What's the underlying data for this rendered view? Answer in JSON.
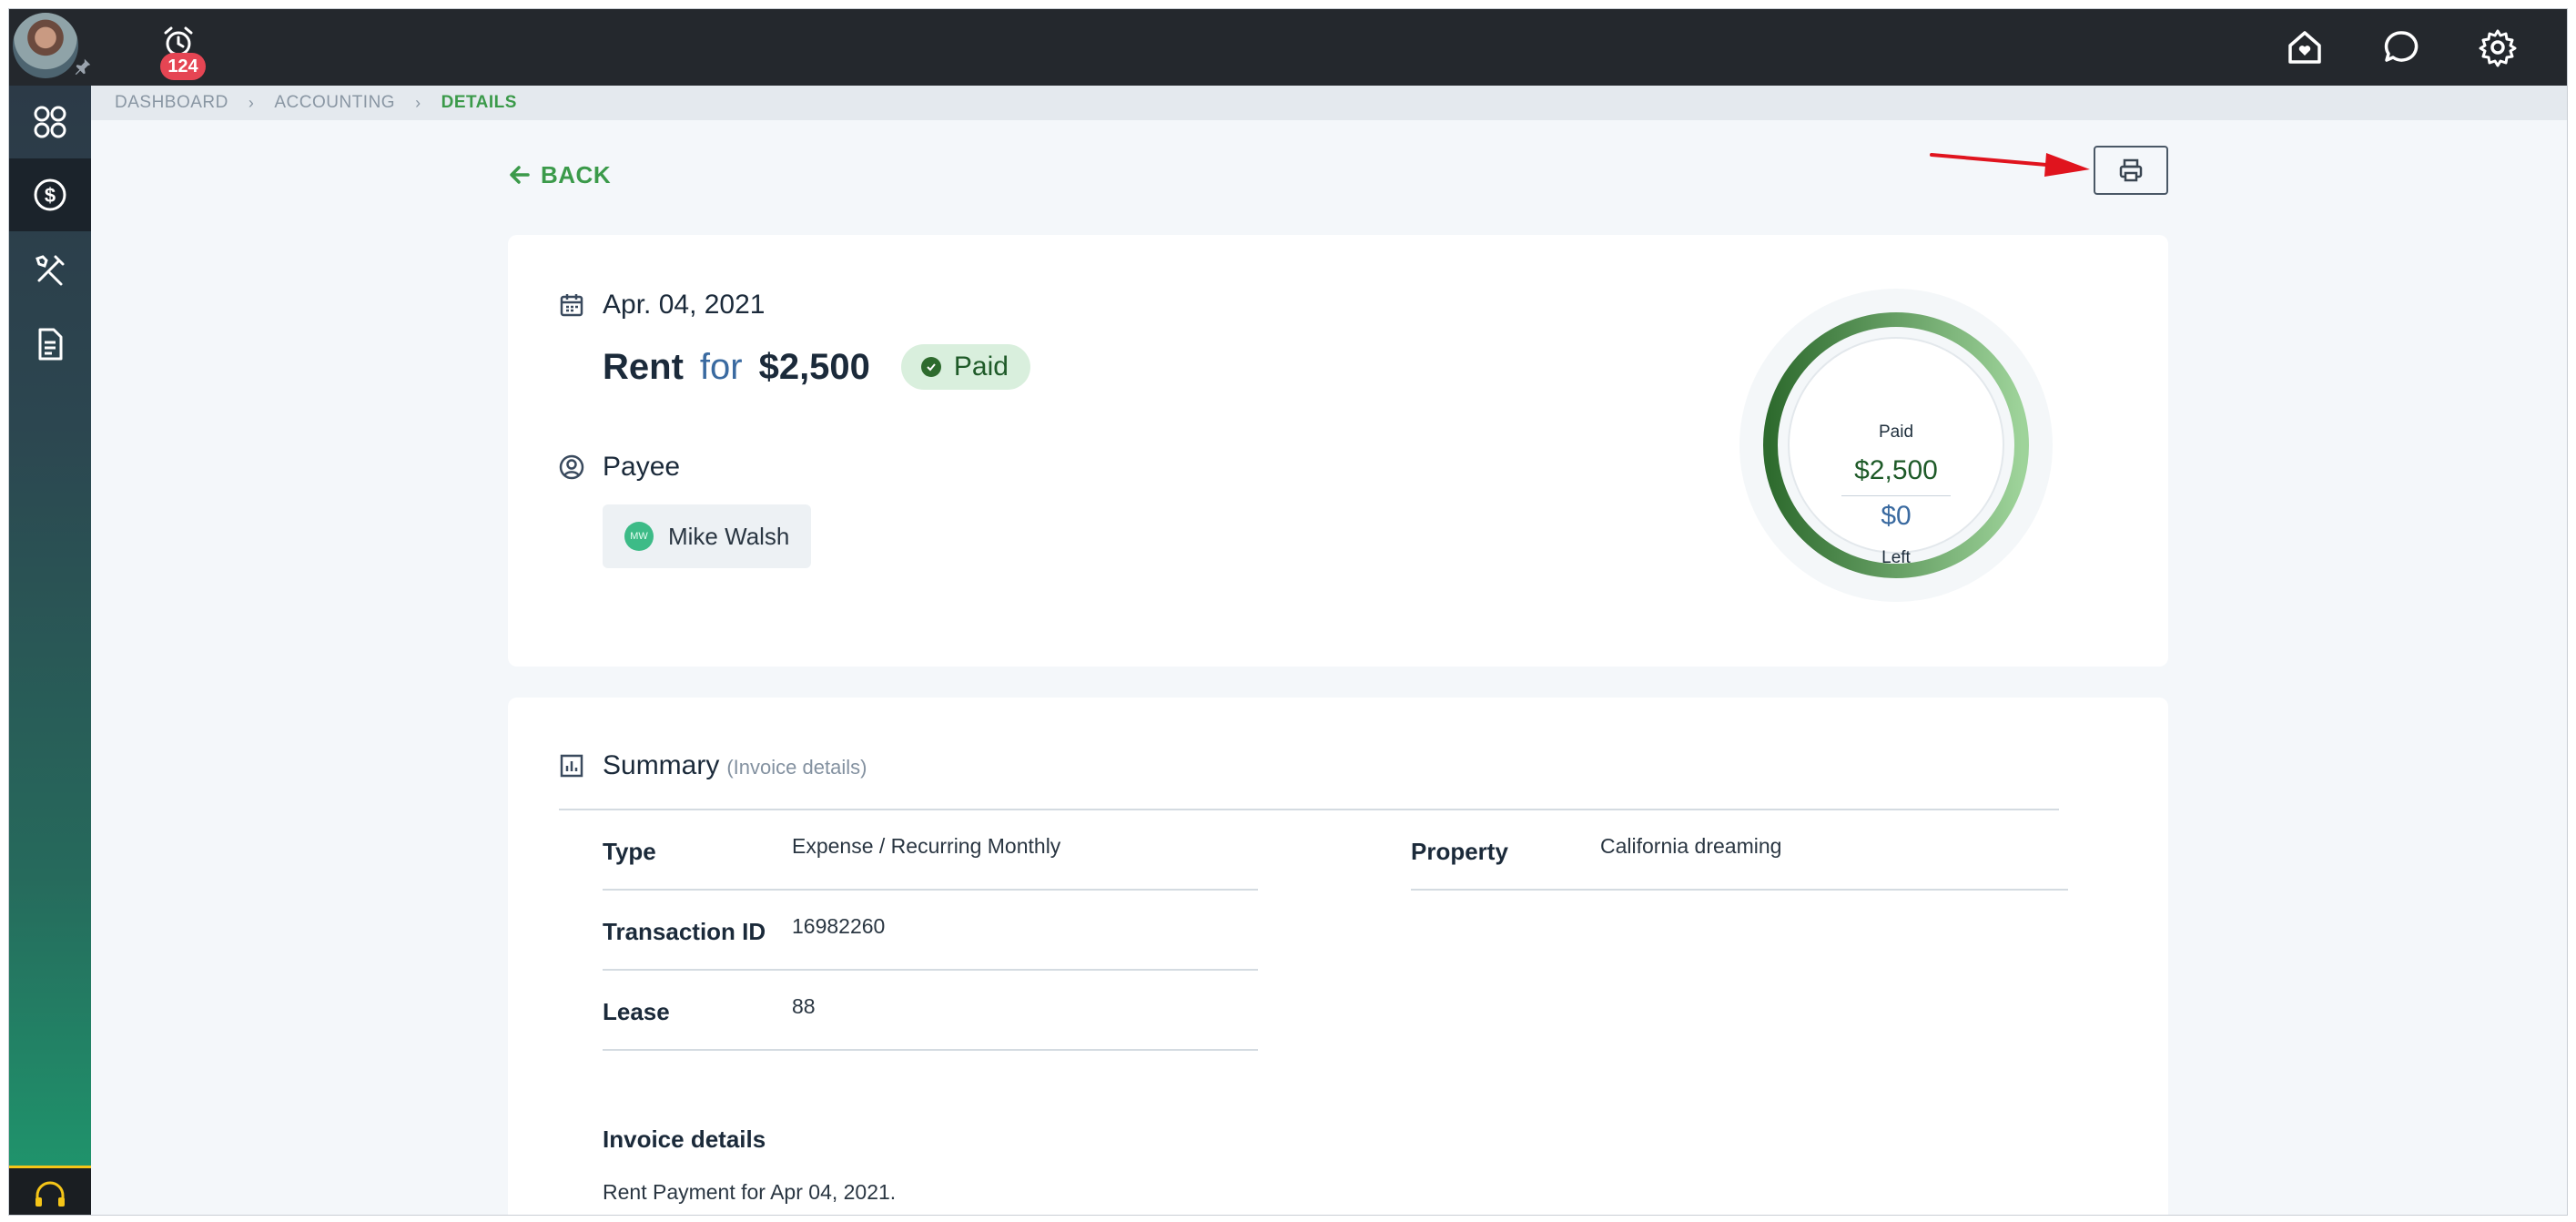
{
  "topbar": {
    "notification_count": "124",
    "icons": [
      "home-heart-icon",
      "chat-icon",
      "gear-icon"
    ]
  },
  "sidebar": {
    "items": [
      "dashboard-icon",
      "dollar-icon",
      "tools-icon",
      "document-icon"
    ],
    "active": "dollar-icon"
  },
  "breadcrumb": {
    "items": [
      "DASHBOARD",
      "ACCOUNTING",
      "DETAILS"
    ]
  },
  "back_label": "BACK",
  "transaction": {
    "date": "Apr. 04, 2021",
    "category": "Rent",
    "for_word": "for",
    "amount": "$2,500",
    "status": "Paid",
    "payee_label": "Payee",
    "payee_initials": "MW",
    "payee_name": "Mike Walsh"
  },
  "progress": {
    "paid_label": "Paid",
    "paid_amount": "$2,500",
    "left_amount": "$0",
    "left_label": "Left",
    "paid_fraction": 1.0
  },
  "summary": {
    "title": "Summary",
    "subtitle": "(Invoice details)",
    "type_label": "Type",
    "type_value": "Expense / Recurring Monthly",
    "transaction_id_label": "Transaction ID",
    "transaction_id_value": "16982260",
    "lease_label": "Lease",
    "lease_value": "88",
    "property_label": "Property",
    "property_value": "California dreaming",
    "invoice_details_label": "Invoice details",
    "invoice_details_text": "Rent Payment for Apr 04, 2021."
  },
  "colors": {
    "accent_green": "#3b9a4a",
    "dark_green": "#2e6b2e",
    "blue": "#3a6aa0",
    "topbar": "#24282d",
    "badge_red": "#e54553"
  }
}
